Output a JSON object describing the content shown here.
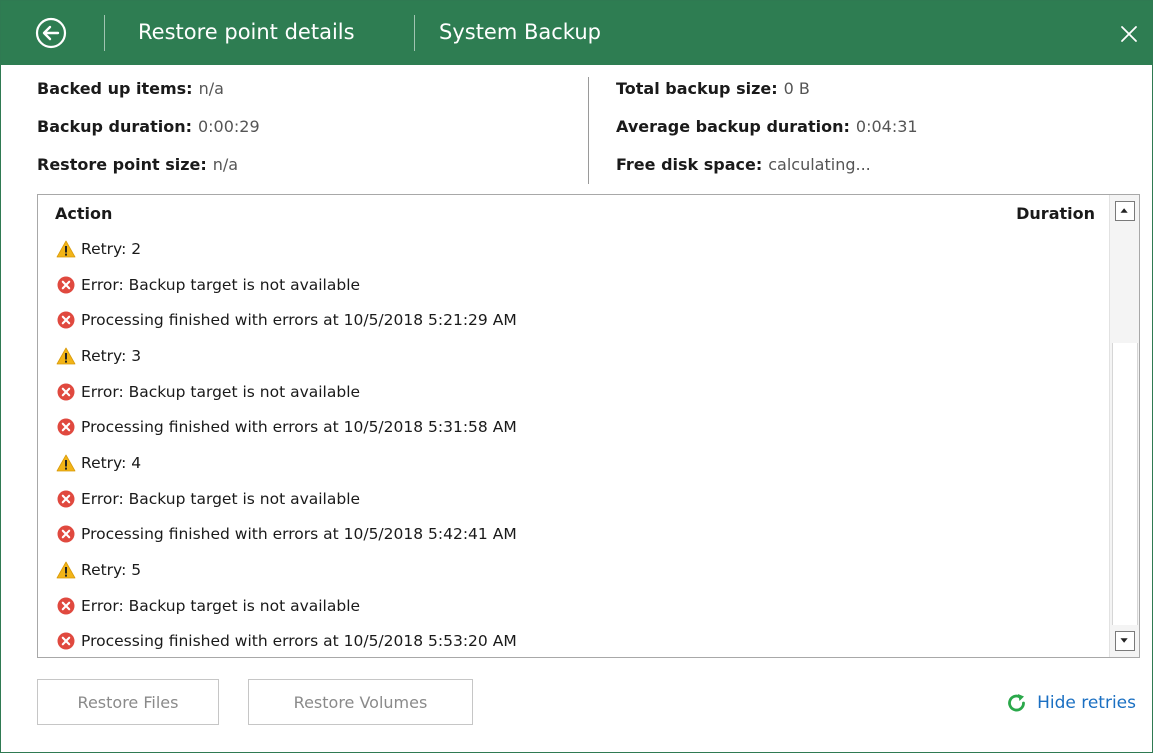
{
  "titlebar": {
    "tab_restore": "Restore point details",
    "tab_backup": "System Backup"
  },
  "summary": {
    "left": [
      {
        "label": "Backed up items:",
        "value": "n/a"
      },
      {
        "label": "Backup duration:",
        "value": "0:00:29"
      },
      {
        "label": "Restore point size:",
        "value": "n/a"
      }
    ],
    "right": [
      {
        "label": "Total backup size:",
        "value": "0 B"
      },
      {
        "label": "Average backup duration:",
        "value": "0:04:31"
      },
      {
        "label": "Free disk space:",
        "value": "calculating..."
      }
    ]
  },
  "log": {
    "headers": {
      "action": "Action",
      "duration": "Duration"
    },
    "rows": [
      {
        "type": "warning-icon",
        "text": "Retry: 2"
      },
      {
        "type": "error-icon",
        "text": "Error: Backup target is not available"
      },
      {
        "type": "error-icon",
        "text": "Processing finished with errors at 10/5/2018 5:21:29 AM"
      },
      {
        "type": "warning-icon",
        "text": "Retry: 3"
      },
      {
        "type": "error-icon",
        "text": "Error: Backup target is not available"
      },
      {
        "type": "error-icon",
        "text": "Processing finished with errors at 10/5/2018 5:31:58 AM"
      },
      {
        "type": "warning-icon",
        "text": "Retry: 4"
      },
      {
        "type": "error-icon",
        "text": "Error: Backup target is not available"
      },
      {
        "type": "error-icon",
        "text": "Processing finished with errors at 10/5/2018 5:42:41 AM"
      },
      {
        "type": "warning-icon",
        "text": "Retry: 5"
      },
      {
        "type": "error-icon",
        "text": "Error: Backup target is not available"
      },
      {
        "type": "error-icon",
        "text": "Processing finished with errors at 10/5/2018 5:53:20 AM"
      }
    ]
  },
  "buttons": {
    "restore_files": "Restore Files",
    "restore_volumes": "Restore Volumes"
  },
  "links": {
    "hide_retries": "Hide retries"
  },
  "colors": {
    "titlebar": "#2e7d52",
    "warning": "#f2b417",
    "error": "#e0493f",
    "link": "#1a6fc2",
    "refresh_icon": "#2aa84a"
  }
}
